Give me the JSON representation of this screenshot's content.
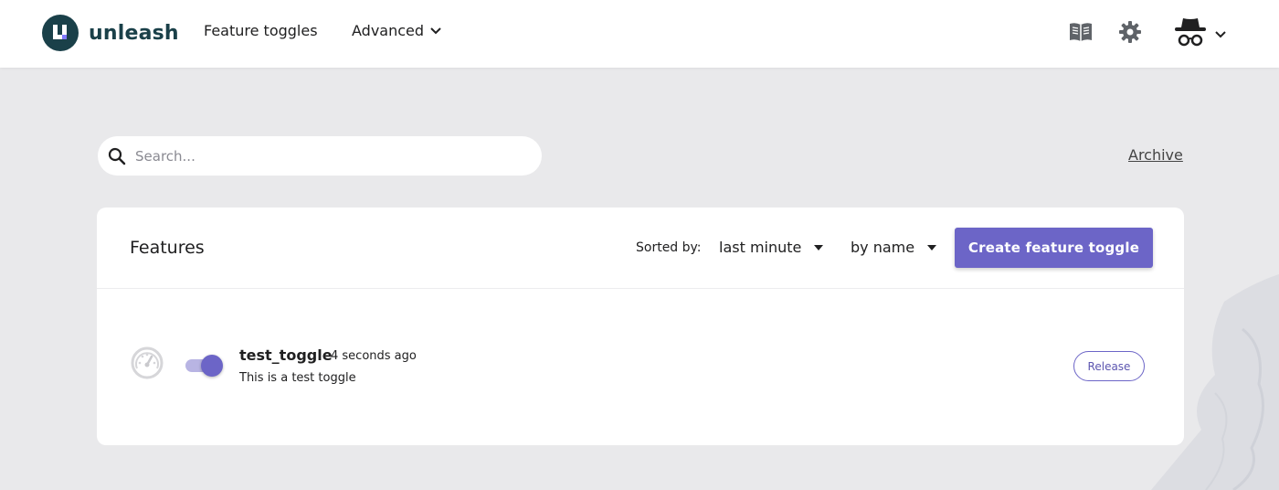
{
  "app": {
    "brand": "unleash",
    "accent_color": "#6c65c7",
    "logo_color": "#1a4049"
  },
  "nav": {
    "features_label": "Feature toggles",
    "advanced_label": "Advanced",
    "icons": {
      "docs": "book-icon",
      "settings": "gear-icon",
      "user": "incognito-avatar-icon"
    }
  },
  "search": {
    "placeholder": "Search...",
    "value": ""
  },
  "archive_label": "Archive",
  "features_card": {
    "title": "Features",
    "sorted_by_label": "Sorted by:",
    "time_filter": "last minute",
    "sort_order": "by name",
    "create_button_label": "Create feature toggle"
  },
  "features": [
    {
      "name": "test_toggle",
      "created": "4 seconds ago",
      "description": "This is a test toggle",
      "enabled": true,
      "type_label": "Release",
      "icon": "gauge-icon"
    }
  ]
}
